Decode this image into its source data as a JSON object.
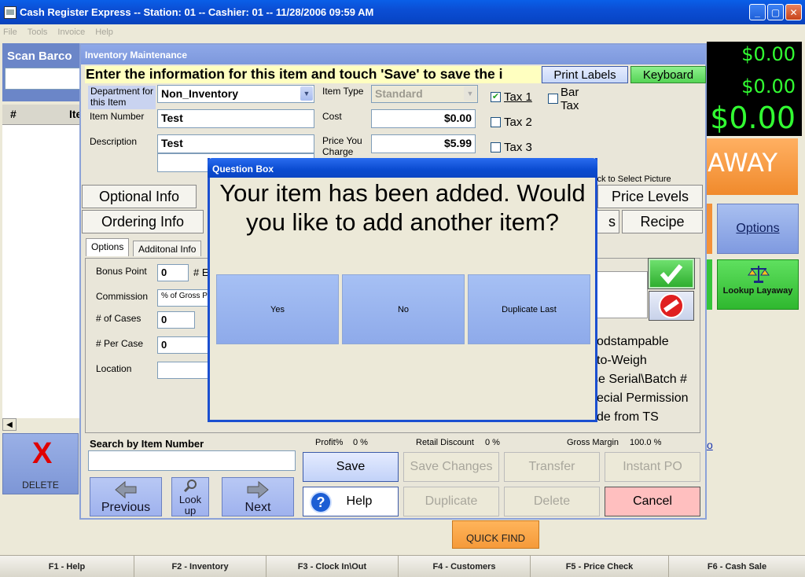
{
  "window": {
    "title": "Cash Register Express -- Station: 01 -- Cashier: 01 -- 11/28/2006 09:59 AM"
  },
  "menu": [
    "File",
    "Tools",
    "Invoice",
    "Help"
  ],
  "background": {
    "scan_label": "Scan Barco",
    "grid_headers": [
      "#",
      "Ite"
    ],
    "delete_label": "DELETE",
    "totals": [
      "$0.00",
      "$0.00",
      "$0.00"
    ],
    "layaway_text": "AWAY",
    "options_label": "Options",
    "lookup_layaway_label": "Lookup Layaway",
    "right_link": "o",
    "quick_find": "QUICK FIND"
  },
  "function_keys": [
    {
      "label": "F1 - Help"
    },
    {
      "label": "F2 - Inventory"
    },
    {
      "label": "F3 - Clock In\\Out"
    },
    {
      "label": "F4 - Customers"
    },
    {
      "label": "F5 - Price Check"
    },
    {
      "label": "F6 - Cash Sale"
    }
  ],
  "inventory": {
    "title": "Inventory Maintenance",
    "banner": "Enter the information for this item and touch 'Save' to save the i",
    "print_labels": "Print Labels",
    "keyboard": "Keyboard",
    "department_label": "Department for this Item",
    "department_value": "Non_Inventory",
    "item_number_label": "Item Number",
    "item_number_value": "Test",
    "description_label": "Description",
    "description_value": "Test",
    "item_type_label": "Item Type",
    "item_type_value": "Standard",
    "cost_label": "Cost",
    "cost_value": "$0.00",
    "price_label": "Price You Charge",
    "price_value": "$5.99",
    "tax1": "Tax 1",
    "tax2": "Tax 2",
    "tax3": "Tax 3",
    "bar_tax": "Bar Tax",
    "select_picture_hint": "ick to Select Picture",
    "tabs": {
      "optional_info": "Optional Info",
      "ordering_info": "Ordering Info",
      "price_levels": "Price Levels",
      "recipe": "Recipe",
      "partial_s": "s"
    },
    "subtabs": {
      "options": "Options",
      "additional": "Additonal Info"
    },
    "options_fields": {
      "bonus_label": "Bonus Point",
      "bonus_value": "0",
      "bonus_suffix": "# E",
      "commission_label": "Commission",
      "commission_value": "% of Gross P",
      "cases_label": "# of Cases",
      "cases_value": "0",
      "per_case_label": "# Per Case",
      "per_case_value": "0",
      "location_label": "Location",
      "location_value": ""
    },
    "right_options": [
      "odstampable",
      "to-Weigh",
      "se Serial\\Batch #",
      "ecial Permission",
      "de from TS"
    ],
    "search_label": "Search by Item Number",
    "search_value": "",
    "profit_label": "Profit%",
    "profit_value": "0 %",
    "retail_discount_label": "Retail Discount",
    "retail_discount_value": "0 %",
    "gross_margin_label": "Gross Margin",
    "gross_margin_value": "100.0 %",
    "buttons": {
      "save": "Save",
      "save_changes": "Save Changes",
      "transfer": "Transfer",
      "instant_po": "Instant PO",
      "help": "Help",
      "duplicate": "Duplicate",
      "delete": "Delete",
      "cancel": "Cancel",
      "previous": "Previous",
      "look_up": "Look up",
      "next": "Next"
    }
  },
  "question_box": {
    "title": "Question Box",
    "message": "Your item has been added. Would you like to add another item?",
    "buttons": [
      "Yes",
      "No",
      "Duplicate Last"
    ]
  }
}
